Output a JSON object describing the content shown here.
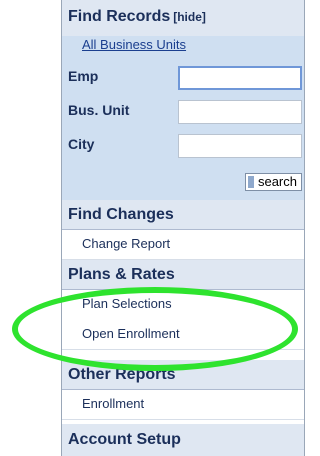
{
  "sidebar": {
    "find_records": {
      "title": "Find Records",
      "toggle": "[hide]",
      "all_units_link": "All Business Units",
      "fields": [
        {
          "label": "Emp",
          "value": ""
        },
        {
          "label": "Bus. Unit",
          "value": ""
        },
        {
          "label": "City",
          "value": ""
        }
      ],
      "search_button": "search"
    },
    "find_changes": {
      "title": "Find Changes",
      "items": [
        "Change Report"
      ]
    },
    "plans_rates": {
      "title": "Plans & Rates",
      "items": [
        "Plan Selections",
        "Open Enrollment"
      ]
    },
    "other_reports": {
      "title": "Other Reports",
      "items": [
        "Enrollment"
      ]
    },
    "account_setup": {
      "title": "Account Setup"
    }
  },
  "annotation": {
    "highlight_color": "#2ee32e"
  },
  "colors": {
    "header_bg": "#dfe7f2",
    "find_records_bg": "#cfdff1",
    "text_navy": "#1b2f5a",
    "link_blue": "#1b3f8f"
  }
}
